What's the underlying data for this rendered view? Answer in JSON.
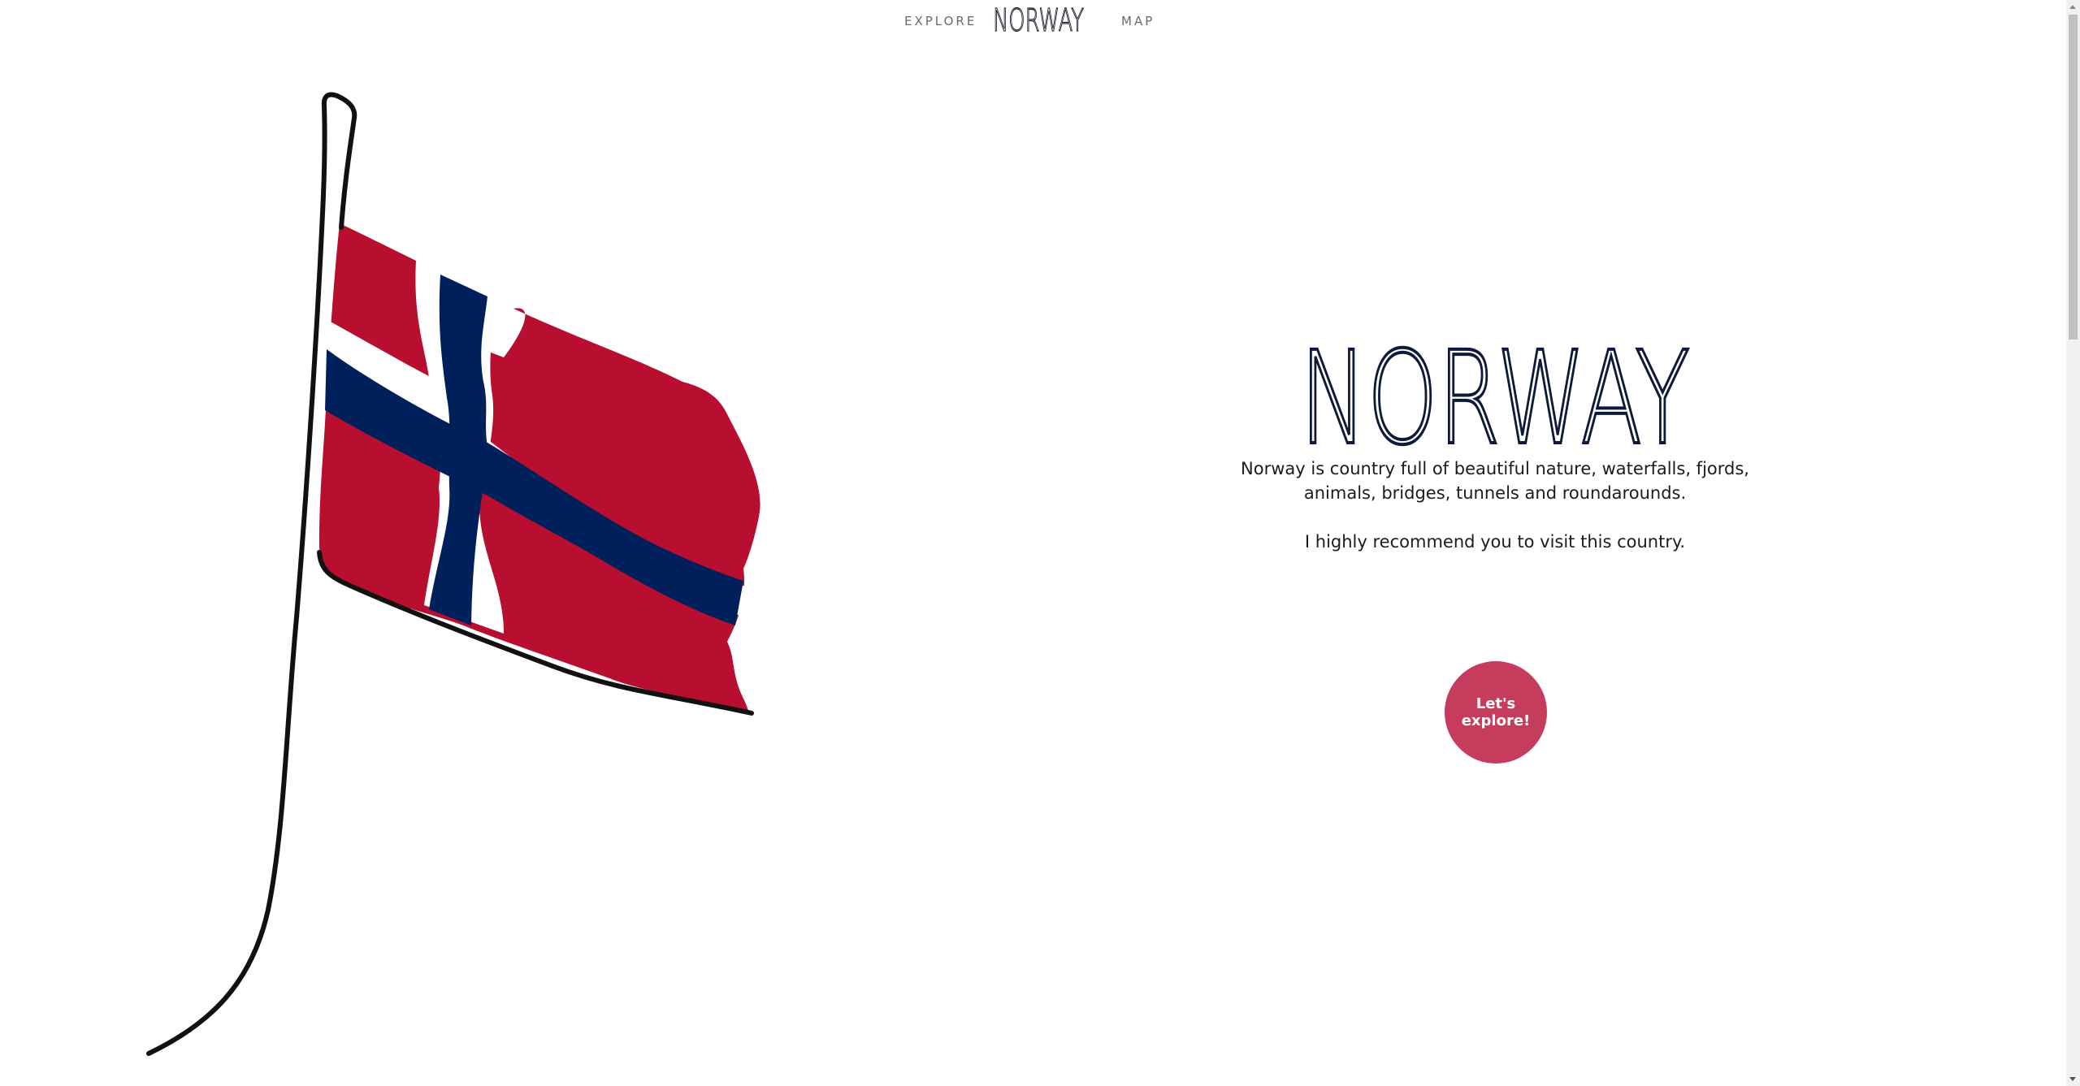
{
  "nav": {
    "explore_label": "EXPLORE",
    "logo_text": "NORWAY",
    "map_label": "MAP"
  },
  "hero": {
    "title": "NORWAY",
    "paragraph1": "Norway is country full of beautiful nature, waterfalls, fjords, animals, bridges, tunnels and roundarounds.",
    "paragraph2": "I highly recommend you to visit this country.",
    "cta_label": "Let's explore!"
  },
  "colors": {
    "flag_red": "#b80e2f",
    "flag_blue": "#00205b",
    "cta": "#c63c5d",
    "title_ink": "#0f1a3a"
  },
  "icons": {
    "flag": "norway-flag-illustration"
  }
}
